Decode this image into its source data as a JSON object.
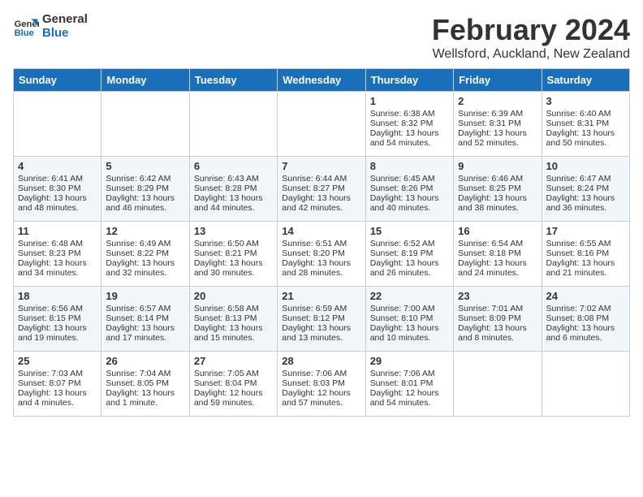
{
  "header": {
    "logo_general": "General",
    "logo_blue": "Blue",
    "month": "February 2024",
    "location": "Wellsford, Auckland, New Zealand"
  },
  "days_of_week": [
    "Sunday",
    "Monday",
    "Tuesday",
    "Wednesday",
    "Thursday",
    "Friday",
    "Saturday"
  ],
  "weeks": [
    [
      {
        "day": "",
        "sunrise": "",
        "sunset": "",
        "daylight": ""
      },
      {
        "day": "",
        "sunrise": "",
        "sunset": "",
        "daylight": ""
      },
      {
        "day": "",
        "sunrise": "",
        "sunset": "",
        "daylight": ""
      },
      {
        "day": "",
        "sunrise": "",
        "sunset": "",
        "daylight": ""
      },
      {
        "day": "1",
        "sunrise": "Sunrise: 6:38 AM",
        "sunset": "Sunset: 8:32 PM",
        "daylight": "Daylight: 13 hours and 54 minutes."
      },
      {
        "day": "2",
        "sunrise": "Sunrise: 6:39 AM",
        "sunset": "Sunset: 8:31 PM",
        "daylight": "Daylight: 13 hours and 52 minutes."
      },
      {
        "day": "3",
        "sunrise": "Sunrise: 6:40 AM",
        "sunset": "Sunset: 8:31 PM",
        "daylight": "Daylight: 13 hours and 50 minutes."
      }
    ],
    [
      {
        "day": "4",
        "sunrise": "Sunrise: 6:41 AM",
        "sunset": "Sunset: 8:30 PM",
        "daylight": "Daylight: 13 hours and 48 minutes."
      },
      {
        "day": "5",
        "sunrise": "Sunrise: 6:42 AM",
        "sunset": "Sunset: 8:29 PM",
        "daylight": "Daylight: 13 hours and 46 minutes."
      },
      {
        "day": "6",
        "sunrise": "Sunrise: 6:43 AM",
        "sunset": "Sunset: 8:28 PM",
        "daylight": "Daylight: 13 hours and 44 minutes."
      },
      {
        "day": "7",
        "sunrise": "Sunrise: 6:44 AM",
        "sunset": "Sunset: 8:27 PM",
        "daylight": "Daylight: 13 hours and 42 minutes."
      },
      {
        "day": "8",
        "sunrise": "Sunrise: 6:45 AM",
        "sunset": "Sunset: 8:26 PM",
        "daylight": "Daylight: 13 hours and 40 minutes."
      },
      {
        "day": "9",
        "sunrise": "Sunrise: 6:46 AM",
        "sunset": "Sunset: 8:25 PM",
        "daylight": "Daylight: 13 hours and 38 minutes."
      },
      {
        "day": "10",
        "sunrise": "Sunrise: 6:47 AM",
        "sunset": "Sunset: 8:24 PM",
        "daylight": "Daylight: 13 hours and 36 minutes."
      }
    ],
    [
      {
        "day": "11",
        "sunrise": "Sunrise: 6:48 AM",
        "sunset": "Sunset: 8:23 PM",
        "daylight": "Daylight: 13 hours and 34 minutes."
      },
      {
        "day": "12",
        "sunrise": "Sunrise: 6:49 AM",
        "sunset": "Sunset: 8:22 PM",
        "daylight": "Daylight: 13 hours and 32 minutes."
      },
      {
        "day": "13",
        "sunrise": "Sunrise: 6:50 AM",
        "sunset": "Sunset: 8:21 PM",
        "daylight": "Daylight: 13 hours and 30 minutes."
      },
      {
        "day": "14",
        "sunrise": "Sunrise: 6:51 AM",
        "sunset": "Sunset: 8:20 PM",
        "daylight": "Daylight: 13 hours and 28 minutes."
      },
      {
        "day": "15",
        "sunrise": "Sunrise: 6:52 AM",
        "sunset": "Sunset: 8:19 PM",
        "daylight": "Daylight: 13 hours and 26 minutes."
      },
      {
        "day": "16",
        "sunrise": "Sunrise: 6:54 AM",
        "sunset": "Sunset: 8:18 PM",
        "daylight": "Daylight: 13 hours and 24 minutes."
      },
      {
        "day": "17",
        "sunrise": "Sunrise: 6:55 AM",
        "sunset": "Sunset: 8:16 PM",
        "daylight": "Daylight: 13 hours and 21 minutes."
      }
    ],
    [
      {
        "day": "18",
        "sunrise": "Sunrise: 6:56 AM",
        "sunset": "Sunset: 8:15 PM",
        "daylight": "Daylight: 13 hours and 19 minutes."
      },
      {
        "day": "19",
        "sunrise": "Sunrise: 6:57 AM",
        "sunset": "Sunset: 8:14 PM",
        "daylight": "Daylight: 13 hours and 17 minutes."
      },
      {
        "day": "20",
        "sunrise": "Sunrise: 6:58 AM",
        "sunset": "Sunset: 8:13 PM",
        "daylight": "Daylight: 13 hours and 15 minutes."
      },
      {
        "day": "21",
        "sunrise": "Sunrise: 6:59 AM",
        "sunset": "Sunset: 8:12 PM",
        "daylight": "Daylight: 13 hours and 13 minutes."
      },
      {
        "day": "22",
        "sunrise": "Sunrise: 7:00 AM",
        "sunset": "Sunset: 8:10 PM",
        "daylight": "Daylight: 13 hours and 10 minutes."
      },
      {
        "day": "23",
        "sunrise": "Sunrise: 7:01 AM",
        "sunset": "Sunset: 8:09 PM",
        "daylight": "Daylight: 13 hours and 8 minutes."
      },
      {
        "day": "24",
        "sunrise": "Sunrise: 7:02 AM",
        "sunset": "Sunset: 8:08 PM",
        "daylight": "Daylight: 13 hours and 6 minutes."
      }
    ],
    [
      {
        "day": "25",
        "sunrise": "Sunrise: 7:03 AM",
        "sunset": "Sunset: 8:07 PM",
        "daylight": "Daylight: 13 hours and 4 minutes."
      },
      {
        "day": "26",
        "sunrise": "Sunrise: 7:04 AM",
        "sunset": "Sunset: 8:05 PM",
        "daylight": "Daylight: 13 hours and 1 minute."
      },
      {
        "day": "27",
        "sunrise": "Sunrise: 7:05 AM",
        "sunset": "Sunset: 8:04 PM",
        "daylight": "Daylight: 12 hours and 59 minutes."
      },
      {
        "day": "28",
        "sunrise": "Sunrise: 7:06 AM",
        "sunset": "Sunset: 8:03 PM",
        "daylight": "Daylight: 12 hours and 57 minutes."
      },
      {
        "day": "29",
        "sunrise": "Sunrise: 7:06 AM",
        "sunset": "Sunset: 8:01 PM",
        "daylight": "Daylight: 12 hours and 54 minutes."
      },
      {
        "day": "",
        "sunrise": "",
        "sunset": "",
        "daylight": ""
      },
      {
        "day": "",
        "sunrise": "",
        "sunset": "",
        "daylight": ""
      }
    ]
  ]
}
